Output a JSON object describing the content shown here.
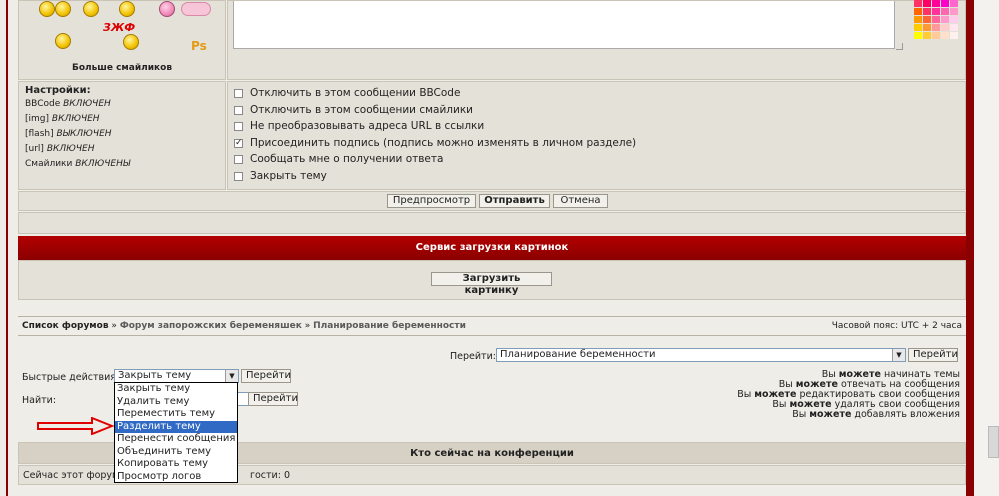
{
  "smilies": {
    "more_label": "Больше смайликов",
    "ps_label": "Ps",
    "zjf_label": "ЗЖФ"
  },
  "settings": {
    "title": "Настройки:",
    "items": [
      {
        "label": "BBCode",
        "value": "ВКЛЮЧЕН"
      },
      {
        "label": "[img]",
        "value": "ВКЛЮЧЕН"
      },
      {
        "label": "[flash]",
        "value": "ВЫКЛЮЧЕН"
      },
      {
        "label": "[url]",
        "value": "ВКЛЮЧЕН"
      },
      {
        "label": "Смайлики",
        "value": "ВКЛЮЧЕНЫ"
      }
    ]
  },
  "options": [
    {
      "label": "Отключить в этом сообщении BBCode",
      "checked": false
    },
    {
      "label": "Отключить в этом сообщении смайлики",
      "checked": false
    },
    {
      "label": "Не преобразовывать адреса URL в ссылки",
      "checked": false
    },
    {
      "label": "Присоединить подпись (подпись можно изменять в личном разделе)",
      "checked": true
    },
    {
      "label": "Сообщать мне о получении ответа",
      "checked": false
    },
    {
      "label": "Закрыть тему",
      "checked": false
    }
  ],
  "buttons": {
    "preview": "Предпросмотр",
    "submit": "Отправить",
    "cancel": "Отмена",
    "upload_image": "Загрузить картинку",
    "go": "Перейти"
  },
  "upload_service": {
    "title": "Сервис загрузки картинок"
  },
  "breadcrumb": {
    "items": [
      "Список форумов",
      "Форум запорожских беременяшек",
      "Планирование беременности"
    ],
    "separator": "»",
    "timezone": "Часовой пояс: UTC + 2 часа"
  },
  "jump": {
    "label": "Перейти:",
    "selected": "Планирование беременности"
  },
  "quick_actions": {
    "label": "Быстрые действия:",
    "selected": "Закрыть тему",
    "options": [
      "Закрыть тему",
      "Удалить тему",
      "Переместить тему",
      "Разделить тему",
      "Перенести сообщения",
      "Объединить тему",
      "Копировать тему",
      "Просмотр логов"
    ],
    "highlighted_index": 3
  },
  "find": {
    "label": "Найти:"
  },
  "permissions": [
    {
      "pre": "Вы ",
      "bold": "можете",
      "post": " начинать темы"
    },
    {
      "pre": "Вы ",
      "bold": "можете",
      "post": " отвечать на сообщения"
    },
    {
      "pre": "Вы ",
      "bold": "можете",
      "post": " редактировать свои сообщения"
    },
    {
      "pre": "Вы ",
      "bold": "можете",
      "post": " удалять свои сообщения"
    },
    {
      "pre": "Вы ",
      "bold": "можете",
      "post": " добавлять вложения"
    }
  ],
  "online": {
    "title": "Кто сейчас на конференции",
    "text_prefix": "Сейчас этот форум",
    "text_suffix": "гости: 0"
  },
  "colors": {
    "accent_red": "#8b0000",
    "panel": "#e4e1d8",
    "highlight": "#316ac5"
  }
}
